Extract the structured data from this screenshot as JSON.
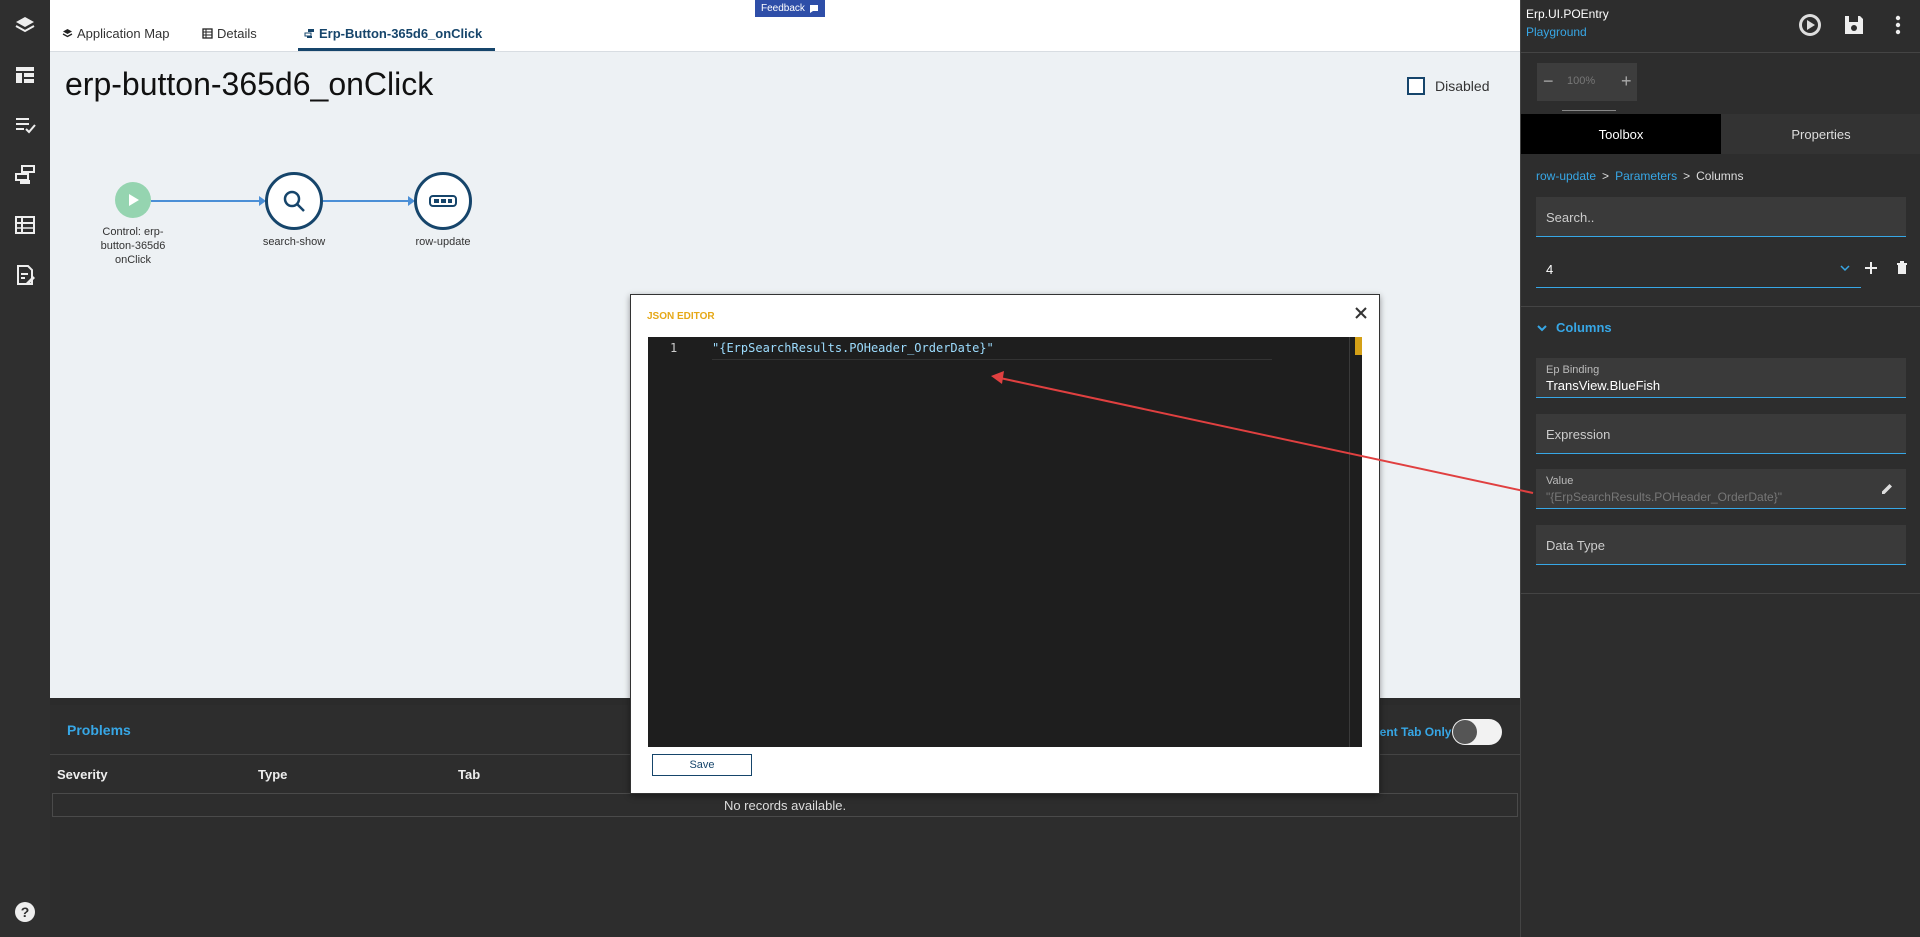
{
  "tabs": [
    {
      "label": "Application Map",
      "icon": "layers-icon"
    },
    {
      "label": "Details",
      "icon": "grid-icon"
    },
    {
      "label": "Erp-Button-365d6_onClick",
      "icon": "flow-icon"
    }
  ],
  "feedback_label": "Feedback",
  "canvas": {
    "title": "erp-button-365d6_onClick",
    "disabled_label": "Disabled",
    "nodes": [
      {
        "label": "Control: erp-button-365d6 onClick",
        "icon": "play-icon"
      },
      {
        "label": "search-show",
        "icon": "search-icon"
      },
      {
        "label": "row-update",
        "icon": "row-icon"
      }
    ]
  },
  "problems": {
    "title": "Problems",
    "current_tab_label": "rent Tab Only",
    "columns": [
      "Severity",
      "Type",
      "Tab"
    ],
    "empty_text": "No records available."
  },
  "right_panel": {
    "app_name": "Erp.UI.POEntry",
    "app_env": "Playground",
    "zoom": "100%",
    "tabs": [
      "Toolbox",
      "Properties"
    ],
    "breadcrumb": [
      "row-update",
      "Parameters",
      "Columns"
    ],
    "search_placeholder": "Search..",
    "selected_value": "4",
    "section_title": "Columns",
    "ep_binding_label": "Ep Binding",
    "ep_binding_value": "TransView.BlueFish",
    "expression_label": "Expression",
    "value_label": "Value",
    "value_text": "\"{ErpSearchResults.POHeader_OrderDate}\"",
    "data_type_label": "Data Type"
  },
  "json_editor": {
    "title": "JSON EDITOR",
    "line_number": "1",
    "code": "\"{ErpSearchResults.POHeader_OrderDate}\"",
    "save_label": "Save"
  },
  "colors": {
    "accent": "#37a7e6",
    "primary": "#16456b",
    "annotation_arrow": "#e04040"
  }
}
